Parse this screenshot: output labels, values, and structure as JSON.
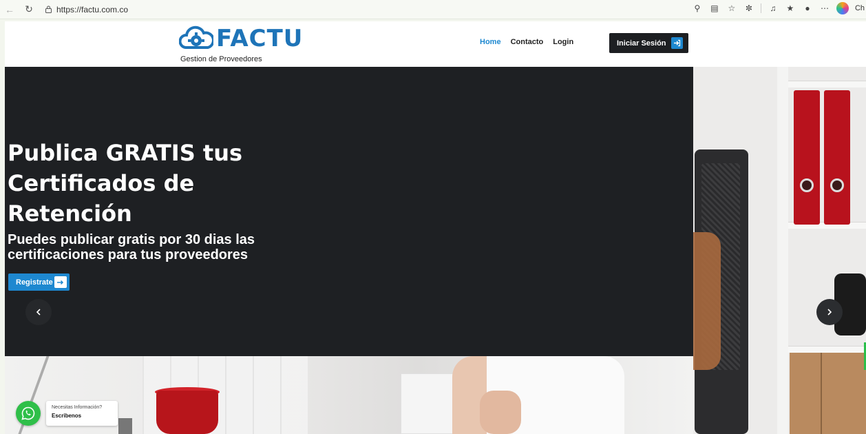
{
  "browser": {
    "url": "https://factu.com.co",
    "copilot_label": "Ch"
  },
  "header": {
    "logo_text": "FACTU",
    "logo_subtitle": "Gestion de Proveedores",
    "nav": [
      {
        "label": "Home",
        "active": true
      },
      {
        "label": "Contacto",
        "active": false
      },
      {
        "label": "Login",
        "active": false
      }
    ],
    "login_button": "Iniciar Sesión"
  },
  "hero": {
    "title": "Publica GRATIS tus Certificados de Retención",
    "subtitle": "Puedes publicar gratis por 30 dias las certificaciones para tus proveedores",
    "cta": "Registrate"
  },
  "whatsapp": {
    "line1": "Necesitas Información?",
    "line2": "Escribenos"
  },
  "colors": {
    "accent": "#1e88d0",
    "logo": "#1e74b8",
    "hero_panel": "#1e2023",
    "whatsapp": "#2fbf49"
  }
}
